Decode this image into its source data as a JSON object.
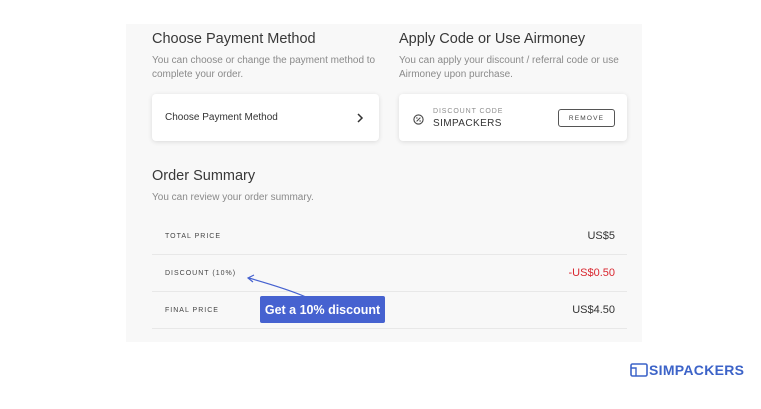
{
  "payment": {
    "title": "Choose Payment Method",
    "description": "You can choose or change the payment method to complete your order.",
    "card_label": "Choose Payment Method"
  },
  "code": {
    "title": "Apply Code or Use Airmoney",
    "description": "You can apply your discount / referral code or use Airmoney upon purchase.",
    "caption": "DISCOUNT CODE",
    "value": "SIMPACKERS",
    "remove_label": "REMOVE"
  },
  "summary": {
    "title": "Order Summary",
    "description": "You can review your order summary.",
    "rows": [
      {
        "label": "TOTAL PRICE",
        "value": "US$5"
      },
      {
        "label": "DISCOUNT (10%)",
        "value": "-US$0.50"
      },
      {
        "label": "FINAL PRICE",
        "value": "US$4.50"
      }
    ]
  },
  "annotation": {
    "text": "Get a 10% discount"
  },
  "brand": {
    "name": "SIMPACKERS"
  },
  "colors": {
    "discount": "#d9262f",
    "annotation_bg": "#4662d0",
    "brand": "#3c63c8"
  },
  "icons": [
    "chevron-right-icon",
    "discount-icon",
    "arrow-icon",
    "logo-card-icon"
  ]
}
